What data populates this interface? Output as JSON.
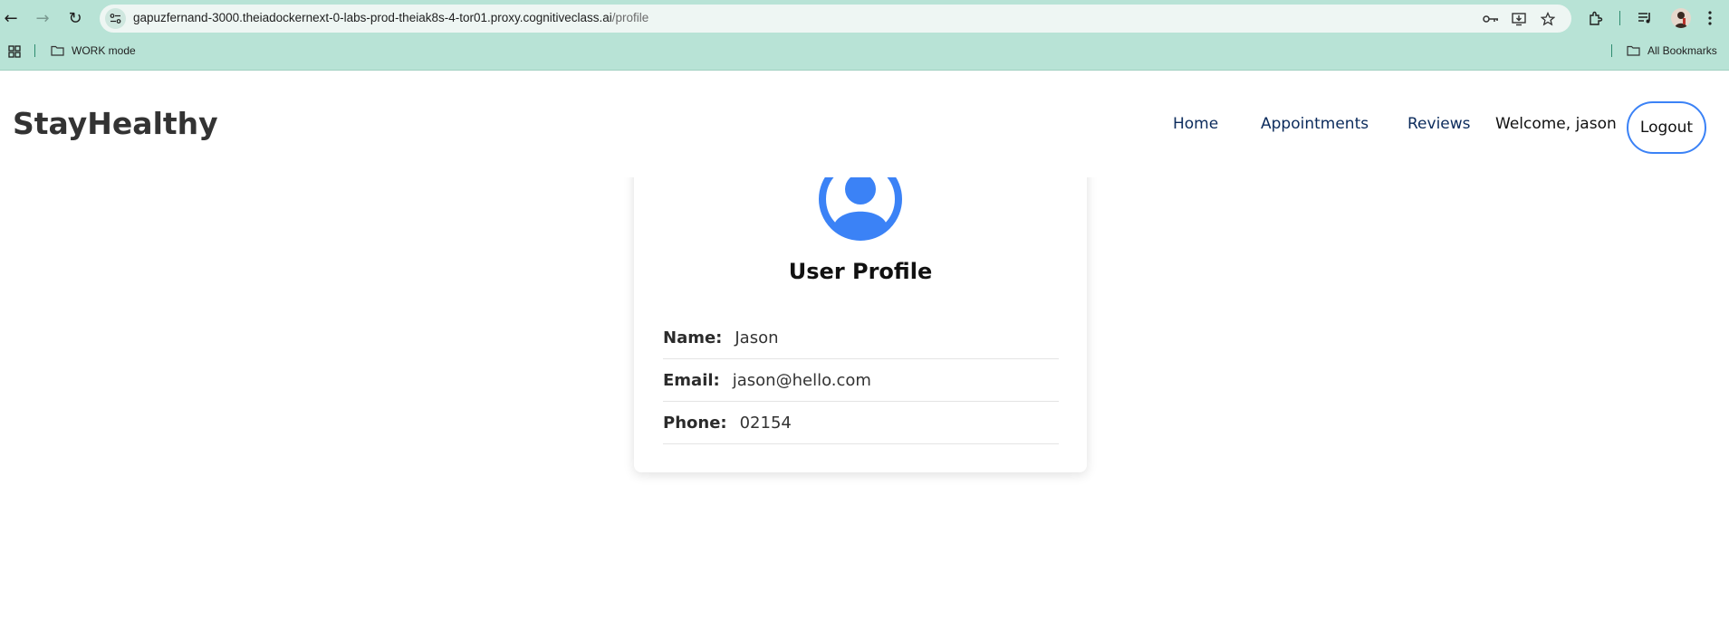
{
  "browser": {
    "url_host": "gapuzfernand-3000.theiadockernext-0-labs-prod-theiak8s-4-tor01.proxy.cognitiveclass.ai",
    "url_path": "/profile",
    "bookmarks": {
      "work_mode": "WORK mode",
      "all_bookmarks": "All Bookmarks"
    },
    "colors": {
      "chrome_bg": "#b8e3d6",
      "omnibox_bg": "#eef6f3"
    }
  },
  "site": {
    "brand": "StayHealthy",
    "nav": {
      "home": "Home",
      "appointments": "Appointments",
      "reviews": "Reviews",
      "welcome": "Welcome, jason",
      "logout": "Logout"
    },
    "profile": {
      "title": "User Profile",
      "avatar_icon": "user-circle-icon",
      "fields": [
        {
          "label": "Name:",
          "value": "Jason"
        },
        {
          "label": "Email:",
          "value": "jason@hello.com"
        },
        {
          "label": "Phone:",
          "value": "02154"
        }
      ]
    },
    "colors": {
      "accent": "#3b82f6",
      "nav_link": "#0b2b5c"
    }
  }
}
